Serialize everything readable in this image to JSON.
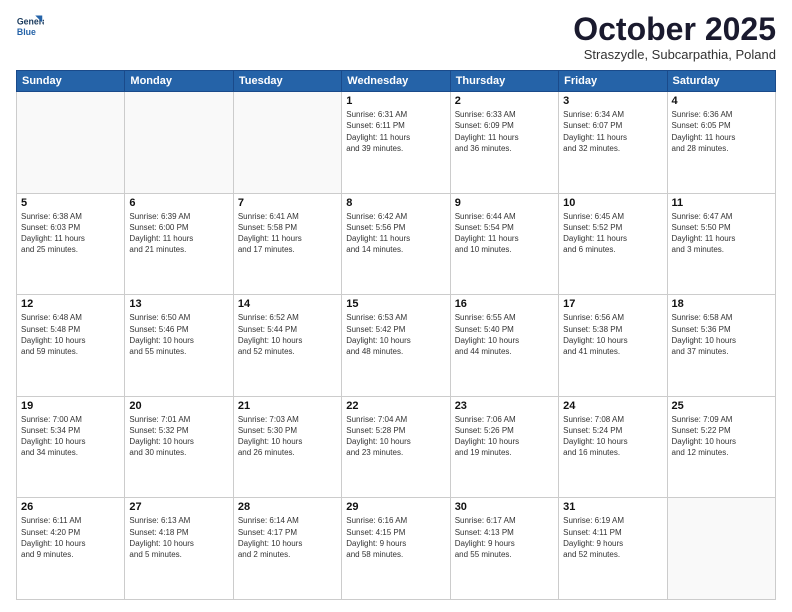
{
  "header": {
    "logo_line1": "General",
    "logo_line2": "Blue",
    "month_title": "October 2025",
    "location": "Straszydle, Subcarpathia, Poland"
  },
  "weekdays": [
    "Sunday",
    "Monday",
    "Tuesday",
    "Wednesday",
    "Thursday",
    "Friday",
    "Saturday"
  ],
  "weeks": [
    [
      {
        "day": "",
        "info": ""
      },
      {
        "day": "",
        "info": ""
      },
      {
        "day": "",
        "info": ""
      },
      {
        "day": "1",
        "info": "Sunrise: 6:31 AM\nSunset: 6:11 PM\nDaylight: 11 hours\nand 39 minutes."
      },
      {
        "day": "2",
        "info": "Sunrise: 6:33 AM\nSunset: 6:09 PM\nDaylight: 11 hours\nand 36 minutes."
      },
      {
        "day": "3",
        "info": "Sunrise: 6:34 AM\nSunset: 6:07 PM\nDaylight: 11 hours\nand 32 minutes."
      },
      {
        "day": "4",
        "info": "Sunrise: 6:36 AM\nSunset: 6:05 PM\nDaylight: 11 hours\nand 28 minutes."
      }
    ],
    [
      {
        "day": "5",
        "info": "Sunrise: 6:38 AM\nSunset: 6:03 PM\nDaylight: 11 hours\nand 25 minutes."
      },
      {
        "day": "6",
        "info": "Sunrise: 6:39 AM\nSunset: 6:00 PM\nDaylight: 11 hours\nand 21 minutes."
      },
      {
        "day": "7",
        "info": "Sunrise: 6:41 AM\nSunset: 5:58 PM\nDaylight: 11 hours\nand 17 minutes."
      },
      {
        "day": "8",
        "info": "Sunrise: 6:42 AM\nSunset: 5:56 PM\nDaylight: 11 hours\nand 14 minutes."
      },
      {
        "day": "9",
        "info": "Sunrise: 6:44 AM\nSunset: 5:54 PM\nDaylight: 11 hours\nand 10 minutes."
      },
      {
        "day": "10",
        "info": "Sunrise: 6:45 AM\nSunset: 5:52 PM\nDaylight: 11 hours\nand 6 minutes."
      },
      {
        "day": "11",
        "info": "Sunrise: 6:47 AM\nSunset: 5:50 PM\nDaylight: 11 hours\nand 3 minutes."
      }
    ],
    [
      {
        "day": "12",
        "info": "Sunrise: 6:48 AM\nSunset: 5:48 PM\nDaylight: 10 hours\nand 59 minutes."
      },
      {
        "day": "13",
        "info": "Sunrise: 6:50 AM\nSunset: 5:46 PM\nDaylight: 10 hours\nand 55 minutes."
      },
      {
        "day": "14",
        "info": "Sunrise: 6:52 AM\nSunset: 5:44 PM\nDaylight: 10 hours\nand 52 minutes."
      },
      {
        "day": "15",
        "info": "Sunrise: 6:53 AM\nSunset: 5:42 PM\nDaylight: 10 hours\nand 48 minutes."
      },
      {
        "day": "16",
        "info": "Sunrise: 6:55 AM\nSunset: 5:40 PM\nDaylight: 10 hours\nand 44 minutes."
      },
      {
        "day": "17",
        "info": "Sunrise: 6:56 AM\nSunset: 5:38 PM\nDaylight: 10 hours\nand 41 minutes."
      },
      {
        "day": "18",
        "info": "Sunrise: 6:58 AM\nSunset: 5:36 PM\nDaylight: 10 hours\nand 37 minutes."
      }
    ],
    [
      {
        "day": "19",
        "info": "Sunrise: 7:00 AM\nSunset: 5:34 PM\nDaylight: 10 hours\nand 34 minutes."
      },
      {
        "day": "20",
        "info": "Sunrise: 7:01 AM\nSunset: 5:32 PM\nDaylight: 10 hours\nand 30 minutes."
      },
      {
        "day": "21",
        "info": "Sunrise: 7:03 AM\nSunset: 5:30 PM\nDaylight: 10 hours\nand 26 minutes."
      },
      {
        "day": "22",
        "info": "Sunrise: 7:04 AM\nSunset: 5:28 PM\nDaylight: 10 hours\nand 23 minutes."
      },
      {
        "day": "23",
        "info": "Sunrise: 7:06 AM\nSunset: 5:26 PM\nDaylight: 10 hours\nand 19 minutes."
      },
      {
        "day": "24",
        "info": "Sunrise: 7:08 AM\nSunset: 5:24 PM\nDaylight: 10 hours\nand 16 minutes."
      },
      {
        "day": "25",
        "info": "Sunrise: 7:09 AM\nSunset: 5:22 PM\nDaylight: 10 hours\nand 12 minutes."
      }
    ],
    [
      {
        "day": "26",
        "info": "Sunrise: 6:11 AM\nSunset: 4:20 PM\nDaylight: 10 hours\nand 9 minutes."
      },
      {
        "day": "27",
        "info": "Sunrise: 6:13 AM\nSunset: 4:18 PM\nDaylight: 10 hours\nand 5 minutes."
      },
      {
        "day": "28",
        "info": "Sunrise: 6:14 AM\nSunset: 4:17 PM\nDaylight: 10 hours\nand 2 minutes."
      },
      {
        "day": "29",
        "info": "Sunrise: 6:16 AM\nSunset: 4:15 PM\nDaylight: 9 hours\nand 58 minutes."
      },
      {
        "day": "30",
        "info": "Sunrise: 6:17 AM\nSunset: 4:13 PM\nDaylight: 9 hours\nand 55 minutes."
      },
      {
        "day": "31",
        "info": "Sunrise: 6:19 AM\nSunset: 4:11 PM\nDaylight: 9 hours\nand 52 minutes."
      },
      {
        "day": "",
        "info": ""
      }
    ]
  ]
}
